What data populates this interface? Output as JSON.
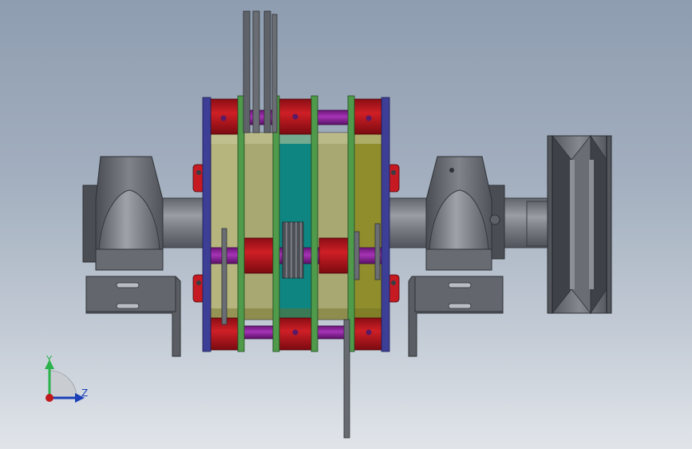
{
  "viewport": {
    "background_top": "#8e9db0",
    "background_bottom": "#e1e5ea"
  },
  "triad": {
    "y_label": "Y",
    "z_label": "Z",
    "y_color": "#2bb24c",
    "z_color": "#1a3fb8",
    "x_color": "#c0191b"
  },
  "colors": {
    "flange_red": "#b3121b",
    "plate_green": "#4e9a4a",
    "plate_blue": "#3e3f93",
    "rod_purple": "#8a1e9a",
    "drum_tan": "#b7b68a",
    "drum_teal": "#138a86",
    "drum_olive": "#8e8c2a",
    "housing_gray": "#5e6268",
    "shaft_gray": "#7a7e84"
  }
}
